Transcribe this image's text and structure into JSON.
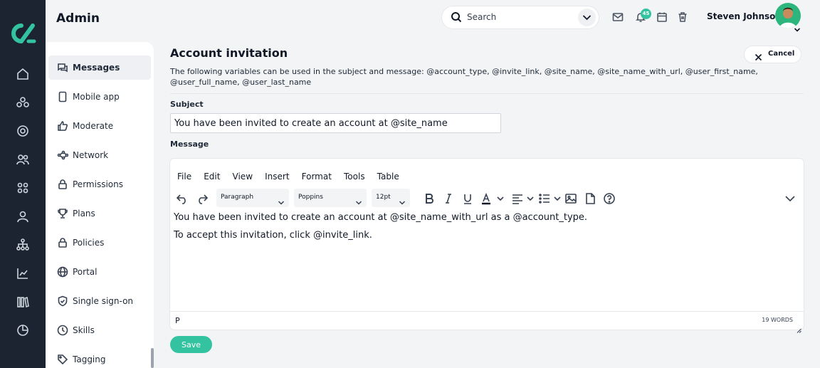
{
  "header": {
    "title": "Admin",
    "search": {
      "placeholder": "Search",
      "icon": "search-icon"
    },
    "notification_count": "45",
    "user": {
      "name": "Steven Johnson"
    }
  },
  "subnav": {
    "items": [
      {
        "label": "Messages",
        "icon": "messages-icon",
        "active": true
      },
      {
        "label": "Mobile app",
        "icon": "mobile-icon"
      },
      {
        "label": "Moderate",
        "icon": "thumbs-up-icon"
      },
      {
        "label": "Network",
        "icon": "network-icon"
      },
      {
        "label": "Permissions",
        "icon": "lock-icon"
      },
      {
        "label": "Plans",
        "icon": "trophy-icon"
      },
      {
        "label": "Policies",
        "icon": "lock-icon"
      },
      {
        "label": "Portal",
        "icon": "globe-icon"
      },
      {
        "label": "Single sign-on",
        "icon": "shield-icon"
      },
      {
        "label": "Skills",
        "icon": "clock-icon"
      },
      {
        "label": "Tagging",
        "icon": "tag-icon"
      }
    ]
  },
  "page": {
    "title": "Account invitation",
    "cancel_label": "Cancel",
    "variables_text": "The following variables can be used in the subject and message: @account_type, @invite_link, @site_name, @site_name_with_url, @user_first_name, @user_full_name, @user_last_name",
    "subject_label": "Subject",
    "subject_value": "You have been invited to create an account at @site_name",
    "message_label": "Message",
    "save_label": "Save"
  },
  "editor": {
    "menu": [
      "File",
      "Edit",
      "View",
      "Insert",
      "Format",
      "Tools",
      "Table"
    ],
    "block_format": "Paragraph",
    "font_family": "Poppins",
    "font_size": "12pt",
    "content": [
      "You have been invited to create an account at @site_name_with_url as a @account_type.",
      "To accept this invitation, click @invite_link."
    ],
    "path": "P",
    "word_count": "19 WORDS"
  },
  "colors": {
    "accent": "#34c3a0",
    "rail": "#1b2430",
    "background": "#f3f4f6"
  }
}
